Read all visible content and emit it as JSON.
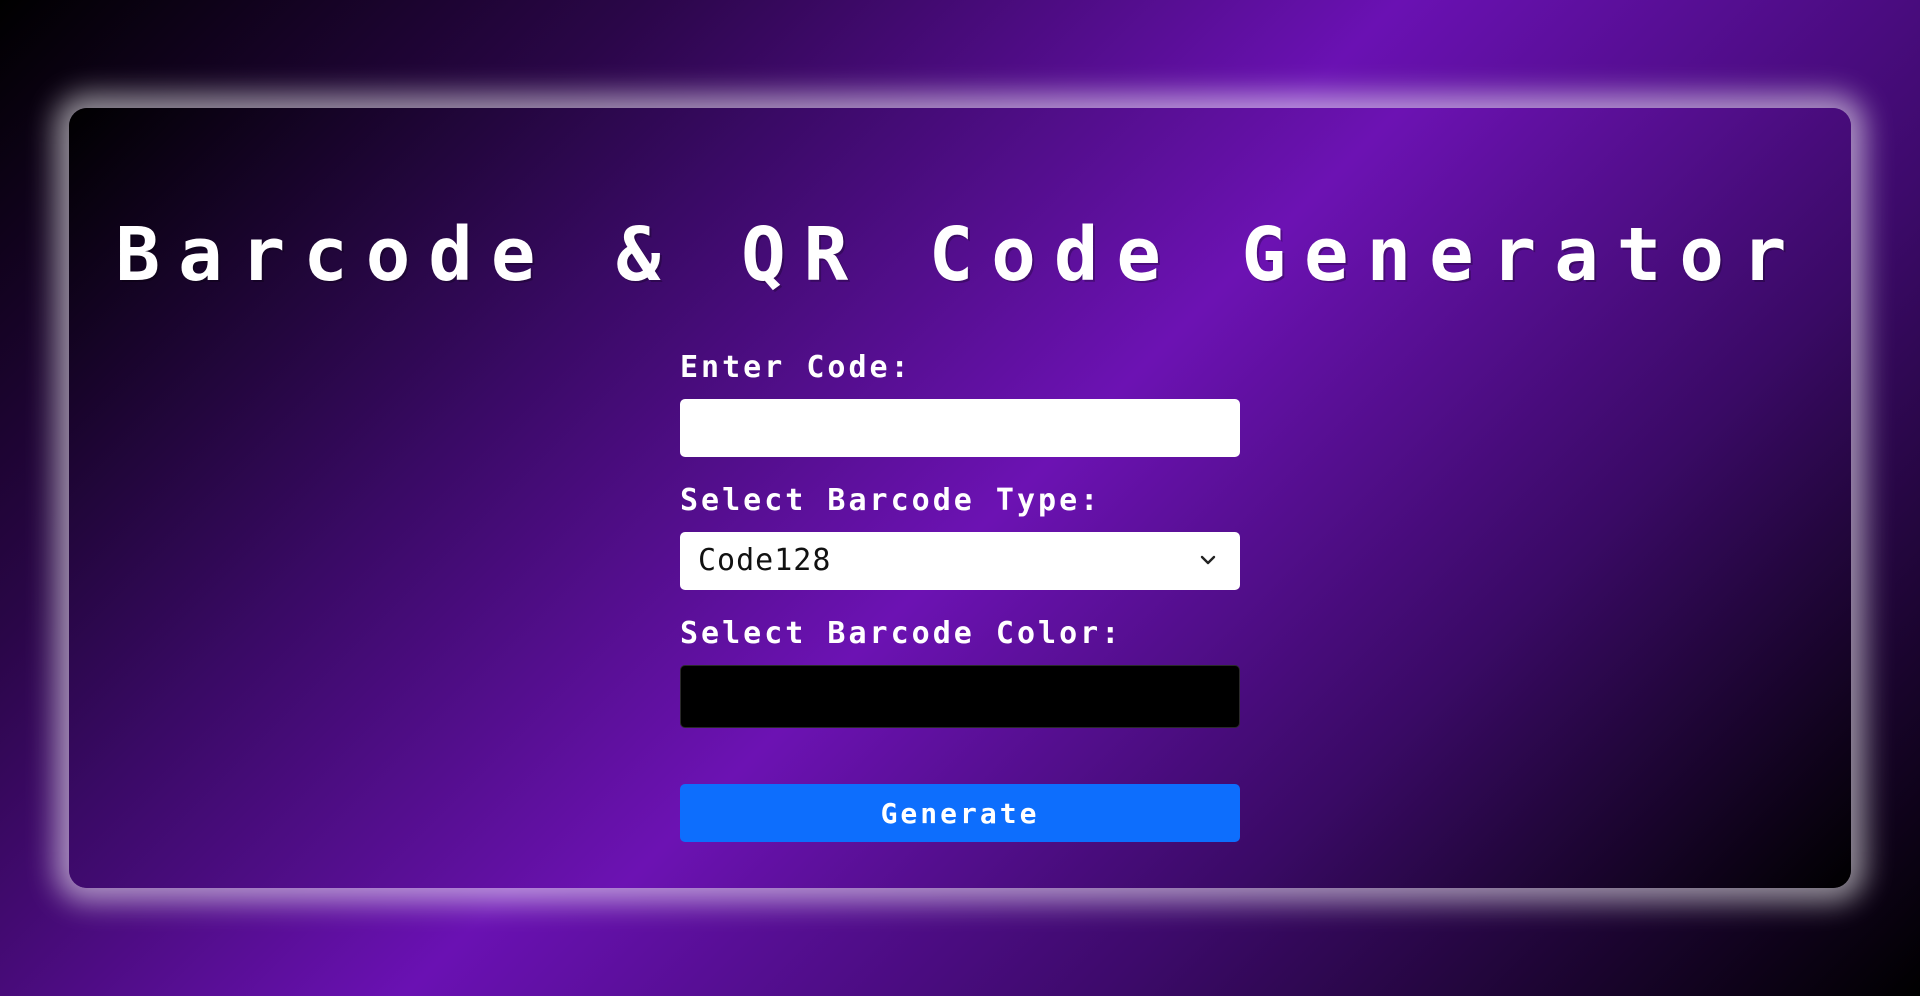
{
  "app": {
    "title": "Barcode & QR Code Generator"
  },
  "form": {
    "code_label": "Enter Code:",
    "code_value": "",
    "code_placeholder": "",
    "type_label": "Select Barcode Type:",
    "type_selected": "Code128",
    "color_label": "Select Barcode Color:",
    "color_value": "#000000",
    "generate_label": "Generate"
  },
  "icons": {
    "select_arrow": "chevron-down-icon"
  },
  "colors": {
    "accent_button": "#0d6efd",
    "title_text": "#ffffff",
    "background_purple": "#6a11b3"
  }
}
